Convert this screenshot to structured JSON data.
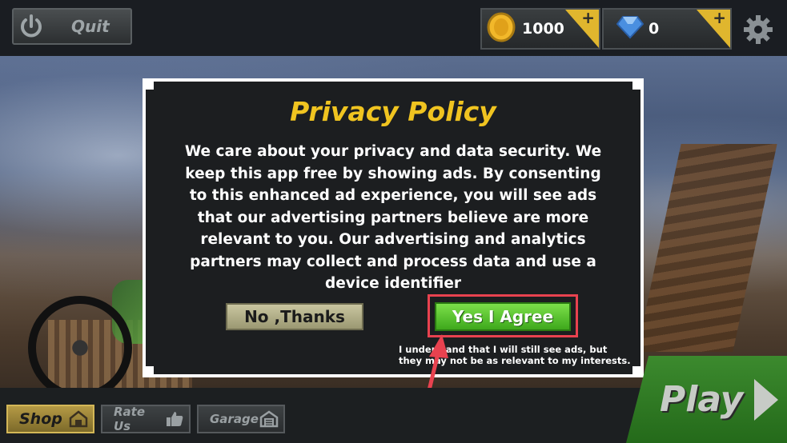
{
  "topbar": {
    "quit_label": "Quit",
    "coins": "1000",
    "gems": "0",
    "plus_label": "+"
  },
  "dialog": {
    "title": "Privacy Policy",
    "body": "We care about your privacy and data security. We keep this app free by showing ads. By consenting to this enhanced ad experience, you will see ads that our advertising partners believe are more relevant to you. Our advertising and analytics partners may collect and process data and use a device identifier",
    "no_label": "No ,Thanks",
    "yes_label": "Yes I Agree",
    "note": "I understand that I will still see ads, but they may not be as relevant to my interests."
  },
  "bottombar": {
    "shop_label": "Shop",
    "rate_label": "Rate Us",
    "garage_label": "Garage",
    "play_label": "Play"
  },
  "colors": {
    "title": "#f0c420",
    "yes_button": "#5cc830",
    "highlight": "#e8424f",
    "play_button": "#2f7d24"
  },
  "icons": [
    "power-icon",
    "coin-icon",
    "gem-icon",
    "gear-icon",
    "house-icon",
    "thumbs-up-icon",
    "garage-icon",
    "play-arrow-icon"
  ]
}
